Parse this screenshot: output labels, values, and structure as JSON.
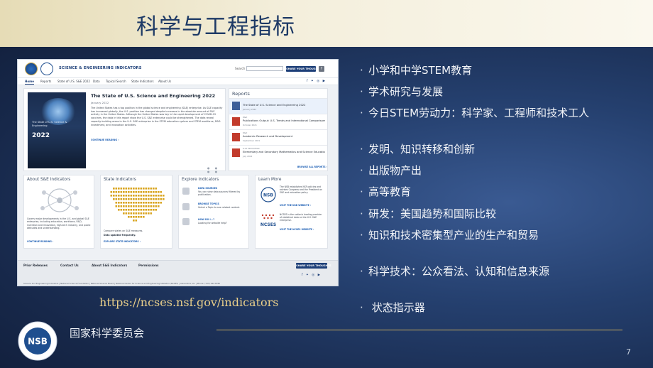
{
  "slide": {
    "title": "科学与工程指标",
    "url": "https://ncses.nsf.gov/indicators",
    "org_name": "国家科学委员会",
    "page_number": "7",
    "seal_text": "NSB"
  },
  "bullets": [
    "小学和中学STEM教育",
    "学术研究与发展",
    "今日STEM劳动力：科学家、工程师和技术工人",
    "发明、知识转移和创新",
    "出版物产出",
    "高等教育",
    "研发：美国趋势和国际比较",
    "知识和技术密集型产业的生产和贸易",
    "科学技术：公众看法、认知和信息来源",
    " 状态指示器"
  ],
  "bullet_marker": "·",
  "website": {
    "logos": {
      "nsf": "NSF",
      "nsb": "NSB"
    },
    "site_title": "SCIENCE & ENGINEERING INDICATORS",
    "search_label": "Search",
    "share_button": "SHARE YOUR THOUGHTS",
    "help_button": "?",
    "nav": [
      "Home",
      "Reports",
      "State of U.S. S&E 2022",
      "Data",
      "Topical Search",
      "State Indicators",
      "About Us"
    ],
    "social": "f ✦ ◎ ▶",
    "hero": {
      "title": "The State of U.S. Science and Engineering 2022",
      "date": "January 2022",
      "description": "The United States has a top position in the global science and engineering (S&E) enterprise. As S&E capacity has increased globally, the U.S. position has changed despite increases in the absolute amount of S&E activity in the United States. Although the United States was key in the rapid development of COVID-19 vaccines, the data in this report show the U.S. S&E enterprise could be strengthened. The data reveal capacity-building areas in the U.S. S&E enterprise in the STEM education system and STEM workforce, R&D investment, and innovation activities.",
      "link": "CONTINUE READING ›",
      "cover_title": "The State of U.S. Science & Engineering",
      "cover_year": "2022",
      "dots": "● ● ● ●"
    },
    "reports": {
      "title": "Reports",
      "items": [
        {
          "category": "",
          "name": "The State of U.S. Science and Engineering 2022",
          "date": "January 2022"
        },
        {
          "category": "R&D",
          "name": "Publications Output: U.S. Trends and International Comparisons",
          "date": "October 2021"
        },
        {
          "category": "R&D",
          "name": "Academic Research and Development",
          "date": "September 2021"
        },
        {
          "category": "K-12 EDUCATION",
          "name": "Elementary and Secondary Mathematics and Science Education",
          "date": "July 2021"
        }
      ],
      "browse": "BROWSE ALL REPORTS ›"
    },
    "cards": {
      "about": {
        "title": "About S&E Indicators",
        "text": "Covers major developments in the U.S. and global S&E enterprise, including education, workforce, R&D, invention and innovation, high-tech industry, and public attitudes and understanding.",
        "link": "CONTINUE READING ›"
      },
      "state": {
        "title": "State Indicators",
        "text": "Compare states on S&E measures.",
        "note": "Data updated frequently.",
        "link": "EXPLORE STATE INDICATORS ›"
      },
      "explore": {
        "title": "Explore Indicators",
        "items": [
          {
            "head": "DATA SOURCES",
            "desc": "You can view data sources filtered by publication."
          },
          {
            "head": "BROWSE TOPICS",
            "desc": "Select a Topic to see related content."
          },
          {
            "head": "HOW DO I...?",
            "desc": "Looking for website help?"
          }
        ]
      },
      "learn": {
        "title": "Learn More",
        "nsb_text": "The NSB establishes NSF policies and advises Congress and the President on S&E and education policy.",
        "nsb_link": "VISIT THE NSB WEBSITE ›",
        "ncses_label": "NCSES",
        "ncses_text": "NCSES is the nation's leading provider of statistical data on the U.S. S&E enterprise.",
        "ncses_link": "VISIT THE NCSES WEBSITE ›"
      }
    },
    "footer": {
      "links": [
        "Prior Releases",
        "Contact Us",
        "About S&E Indicators",
        "Permissions"
      ],
      "share_button": "SHARE YOUR THOUGHTS",
      "legal": "Science and Engineering Indicators  |  National Science Foundation  |  National Science Board  |  National Center for Science and Engineering Statistics (NCSES)  |  Alexandria, Va.  |  Phone: (703) 292-8780"
    }
  },
  "colors": {
    "title_text": "#1e3a66",
    "accent_gold": "#c9ac5e",
    "url_text": "#e9cf8a",
    "site_blue": "#1d3f78"
  }
}
